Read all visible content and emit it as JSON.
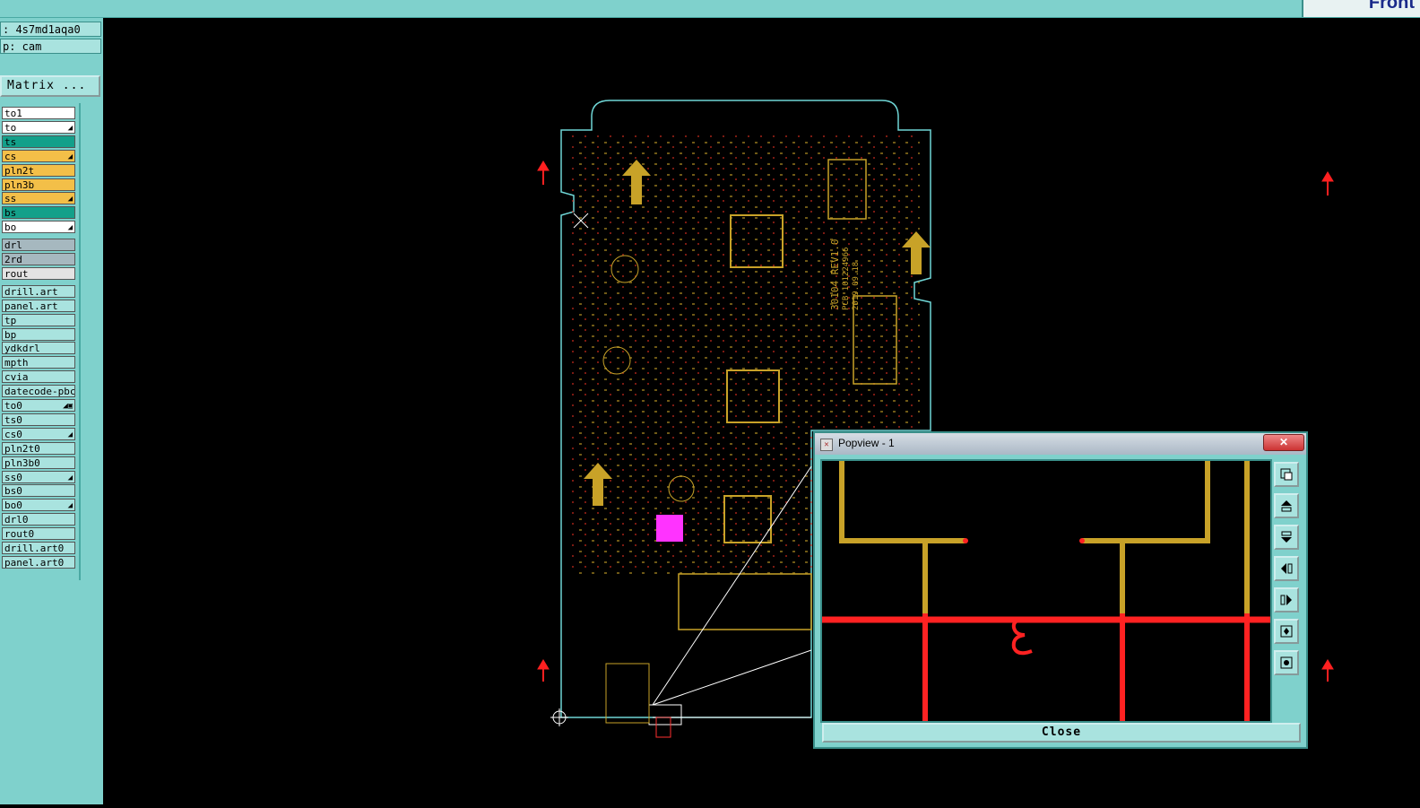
{
  "header": {
    "job_label": ": 4s7md1aqa0",
    "step_label": "p: cam",
    "brand_text": "Front"
  },
  "matrix_button": "Matrix ...",
  "layers": [
    {
      "name": "to1",
      "color": "#ffffff",
      "mark": ""
    },
    {
      "name": "to",
      "color": "#ffffff",
      "mark": "◢"
    },
    {
      "name": "ts",
      "color": "#13a08a",
      "mark": ""
    },
    {
      "name": "cs",
      "color": "#f3bf48",
      "mark": "◢"
    },
    {
      "name": "pln2t",
      "color": "#f3bf48",
      "mark": ""
    },
    {
      "name": "pln3b",
      "color": "#f3bf48",
      "mark": ""
    },
    {
      "name": "ss",
      "color": "#f3bf48",
      "mark": "◢"
    },
    {
      "name": "bs",
      "color": "#13a08a",
      "mark": ""
    },
    {
      "name": "bo",
      "color": "#ffffff",
      "mark": "◢"
    },
    {
      "name": "drl",
      "color": "#a6b8bf",
      "mark": ""
    },
    {
      "name": "2rd",
      "color": "#a6b8bf",
      "mark": ""
    },
    {
      "name": "rout",
      "color": "#e3e3e3",
      "mark": ""
    },
    {
      "name": "drill.art",
      "color": "#a9e3df",
      "mark": ""
    },
    {
      "name": "panel.art",
      "color": "#a9e3df",
      "mark": ""
    },
    {
      "name": "tp",
      "color": "#a9e3df",
      "mark": ""
    },
    {
      "name": "bp",
      "color": "#a9e3df",
      "mark": ""
    },
    {
      "name": "ydkdrl",
      "color": "#a9e3df",
      "mark": ""
    },
    {
      "name": "mpth",
      "color": "#a9e3df",
      "mark": ""
    },
    {
      "name": "cvia",
      "color": "#a9e3df",
      "mark": ""
    },
    {
      "name": "datecode-pbc",
      "color": "#a9e3df",
      "mark": ""
    },
    {
      "name": "to0",
      "color": "#a9e3df",
      "mark": "◢▣"
    },
    {
      "name": "ts0",
      "color": "#a9e3df",
      "mark": ""
    },
    {
      "name": "cs0",
      "color": "#a9e3df",
      "mark": "◢"
    },
    {
      "name": "pln2t0",
      "color": "#a9e3df",
      "mark": ""
    },
    {
      "name": "pln3b0",
      "color": "#a9e3df",
      "mark": ""
    },
    {
      "name": "ss0",
      "color": "#a9e3df",
      "mark": "◢"
    },
    {
      "name": "bs0",
      "color": "#a9e3df",
      "mark": ""
    },
    {
      "name": "bo0",
      "color": "#a9e3df",
      "mark": "◢"
    },
    {
      "name": "drl0",
      "color": "#a9e3df",
      "mark": ""
    },
    {
      "name": "rout0",
      "color": "#a9e3df",
      "mark": ""
    },
    {
      "name": "drill.art0",
      "color": "#a9e3df",
      "mark": ""
    },
    {
      "name": "panel.art0",
      "color": "#a9e3df",
      "mark": ""
    }
  ],
  "board": {
    "silk_text_1": "30104 REV1.0",
    "silk_text_2": "PCB 101224966",
    "silk_text_3": "2019.09.18"
  },
  "popview": {
    "title": "Popview - 1",
    "close_label": "Close",
    "close_x": "✕"
  },
  "colors": {
    "panel": "#7fd1cc",
    "trace_gold": "#c8a228",
    "trace_red": "#ff2222",
    "outline": "#6fd6d6",
    "highlight": "#ff33ff"
  }
}
